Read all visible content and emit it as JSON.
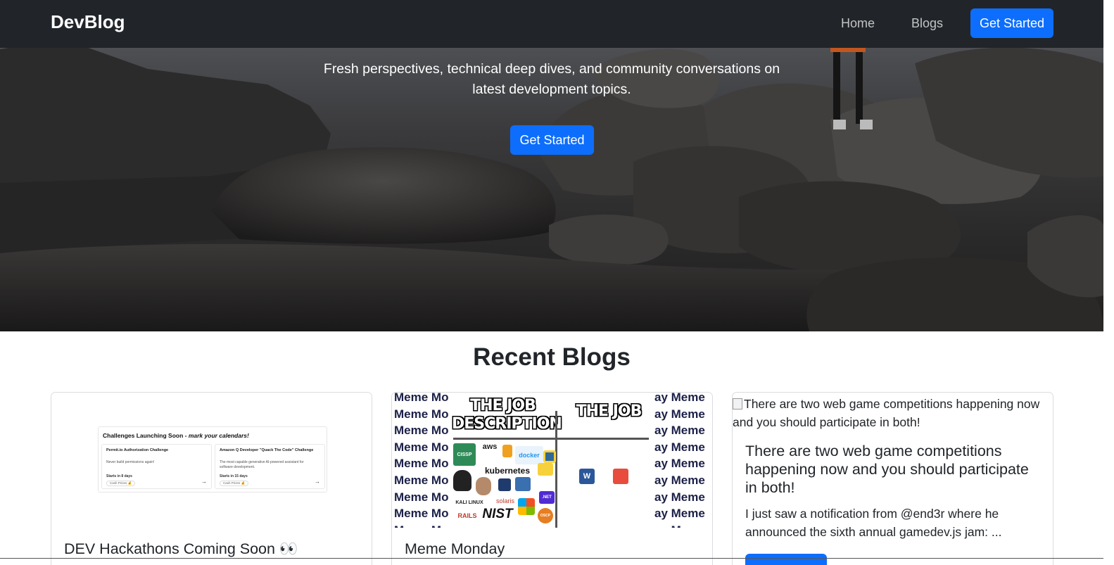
{
  "navbar": {
    "brand": "DevBlog",
    "links": [
      {
        "label": "Home"
      },
      {
        "label": "Blogs"
      }
    ],
    "cta_label": "Get Started"
  },
  "hero": {
    "subtitle": "Fresh perspectives, technical deep dives, and community conversations on latest development topics.",
    "cta_label": "Get Started"
  },
  "section": {
    "title": "Recent Blogs"
  },
  "cards": [
    {
      "title": "DEV Hackathons Coming Soon 👀",
      "image": {
        "heading": "Challenges Launching Soon - ",
        "heading_em": "mark your calendars!",
        "items": [
          {
            "name": "Permit.io Authorization Challenge",
            "desc": "Never build permissions again!",
            "starts": "Starts in 8 days",
            "prize": "Cash Prizes 💰"
          },
          {
            "name": "Amazon Q Developer \"Quack The Code\" Challenge",
            "desc": "The most capable generative AI-powered assistant for software development.",
            "starts": "Starts in 15 days",
            "prize": "Cash Prizes 💰"
          }
        ]
      }
    },
    {
      "title": "Meme Monday",
      "image": {
        "repeat_text": "Meme Mo",
        "repeat_text_right": "ay Meme",
        "panel_left": "THE JOB DESCRIPTION",
        "panel_right": "THE JOB",
        "logos": {
          "cissp": "CISSP",
          "aws": "aws",
          "kubernetes": "kubernetes",
          "docker": "docker",
          "kali": "KALI LINUX",
          "solaris": "solaris",
          "rails": "RAILS",
          "nist": "NIST",
          "net": ".NET",
          "oscp": "OSCP",
          "word": "W"
        }
      }
    },
    {
      "image_alt": "There are two web game competitions happening now and you should participate in both!",
      "title": "There are two web game competitions happening now and you should participate in both!",
      "excerpt": "I just saw a notification from @end3r where he announced the sixth annual gamedev.js jam: ..."
    }
  ],
  "colors": {
    "navbar_bg": "#212529",
    "primary": "#0d6efd",
    "text": "#212529"
  }
}
